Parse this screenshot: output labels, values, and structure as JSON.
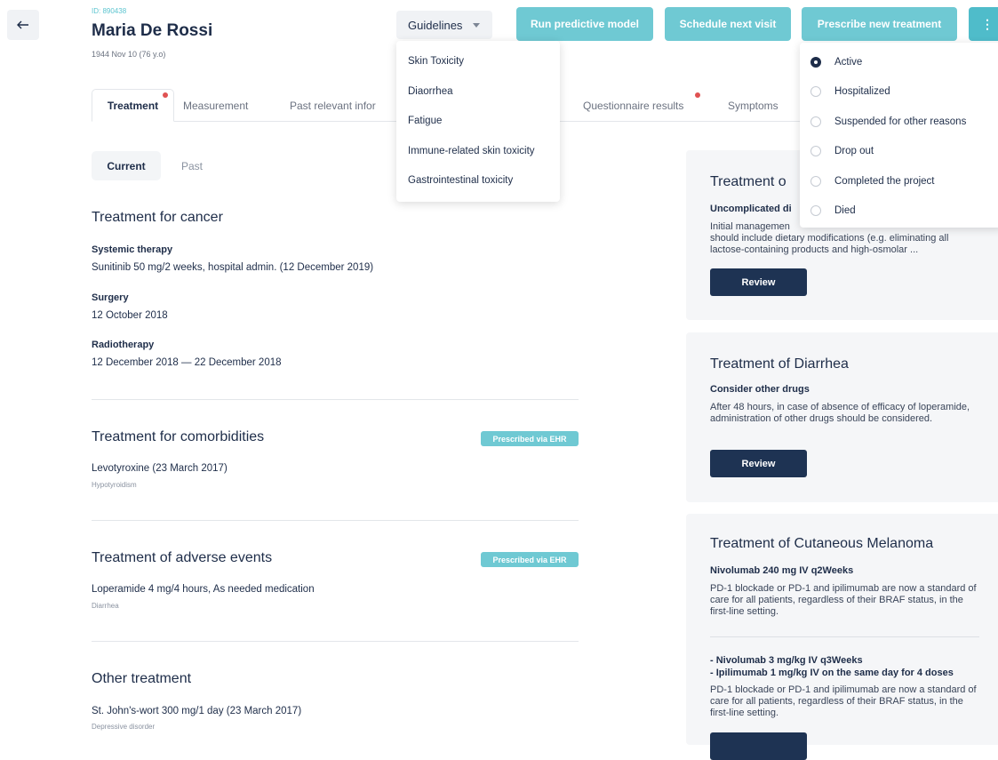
{
  "header": {
    "back_icon": "arrow-left-icon",
    "patient_id": "ID: 890438",
    "patient_name": "Maria De Rossi",
    "dob": "1944 Nov 10 (76 y.o)",
    "guidelines_label": "Guidelines",
    "run_model_label": "Run predictive model",
    "schedule_label": "Schedule next visit",
    "prescribe_label": "Prescribe new treatment",
    "more_label": "⋮"
  },
  "tabs": [
    {
      "label": "Treatment",
      "active": true,
      "dot": true
    },
    {
      "label": "Measurement"
    },
    {
      "label": "Past relevant infor"
    },
    {
      "label": "Questionnaire results",
      "dot": true
    },
    {
      "label": "Symptoms"
    }
  ],
  "subtabs": {
    "current": "Current",
    "past": "Past"
  },
  "cancer": {
    "title": "Treatment for cancer",
    "systemic_label": "Systemic therapy",
    "systemic_value": "Sunitinib 50 mg/2 weeks, hospital admin. (12 December 2019)",
    "surgery_label": "Surgery",
    "surgery_value": "12 October 2018",
    "radio_label": "Radiotherapy",
    "radio_value": "12 December 2018 — 22 December 2018"
  },
  "comorbidities": {
    "title": "Treatment for comorbidities",
    "badge": "Prescribed via EHR",
    "value": "Levotyroxine (23 March 2017)",
    "note": "Hypotyroidism"
  },
  "adverse": {
    "title": "Treatment of adverse events",
    "badge": "Prescribed via EHR",
    "value": "Loperamide 4 mg/4 hours, As needed medication",
    "note": "Diarrhea"
  },
  "other": {
    "title": "Other treatment",
    "value": "St. John's-wort 300 mg/1 day (23 March 2017)",
    "note": "Depressive disorder"
  },
  "cards": [
    {
      "title": "Treatment of Diarrhea",
      "title_visible": "Treatment o",
      "subtitle_visible": "Uncomplicated di",
      "text_line1": "Initial managemen",
      "text_rest": "should include dietary modifications (e.g. eliminating all lactose-containing products and high-osmolar ...",
      "button": "Review"
    },
    {
      "title": "Treatment of Diarrhea",
      "subtitle": "Consider other drugs",
      "text": "After 48 hours, in case of absence of efficacy of loperamide, administration of other drugs should be considered.",
      "button": "Review"
    },
    {
      "title": "Treatment of Cutaneous Melanoma",
      "subtitle": "Nivolumab 240 mg IV q2Weeks",
      "text": "PD-1 blockade or PD-1 and ipilimumab are now a standard of care for all patients, regardless of their BRAF status, in the first-line setting.",
      "subtitle2_line1": "- Nivolumab 3 mg/kg IV q3Weeks",
      "subtitle2_line2": "- Ipilimumab 1 mg/kg IV on the same day for 4 doses",
      "text2": "PD-1 blockade or PD-1 and ipilimumab are now a standard of care for all patients, regardless of their BRAF status, in the first-line setting."
    }
  ],
  "guidelines_menu": [
    "Skin Toxicity",
    "Diaorrhea",
    "Fatigue",
    "Immune-related skin toxicity",
    "Gastrointestinal toxicity"
  ],
  "status_menu": [
    {
      "label": "Active",
      "checked": true
    },
    {
      "label": "Hospitalized"
    },
    {
      "label": "Suspended for other reasons"
    },
    {
      "label": "Drop out"
    },
    {
      "label": "Completed the project"
    },
    {
      "label": "Died"
    }
  ],
  "colors": {
    "accent": "#6fc9d3",
    "dark": "#1e3353",
    "alert_dot": "#e05252"
  }
}
